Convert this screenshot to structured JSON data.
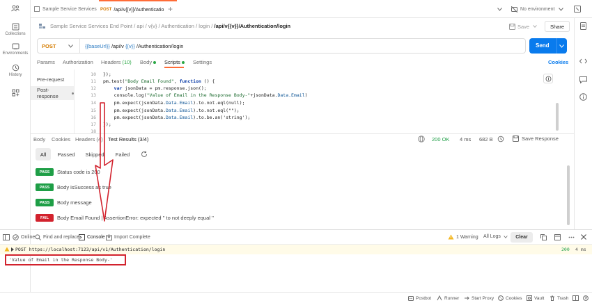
{
  "sidebar": {
    "items": [
      {
        "label": "",
        "icon": "team-icon"
      },
      {
        "label": "Collections",
        "icon": "collections-icon"
      },
      {
        "label": "Environments",
        "icon": "environments-icon"
      },
      {
        "label": "History",
        "icon": "history-icon"
      },
      {
        "label": "",
        "icon": "apps-icon"
      }
    ]
  },
  "tabs": [
    {
      "label": "Sample Service Services",
      "method": ""
    },
    {
      "label": "/api/v{{v}}/Authenticatio",
      "method": "POST"
    }
  ],
  "environment": {
    "label": "No environment"
  },
  "breadcrumb": {
    "items": [
      "Sample Service Services End Point",
      "api",
      "v{v}",
      "Authentication",
      "login"
    ],
    "last": "/api/v{{v}}/Authentication/login"
  },
  "actions": {
    "save": "Save",
    "share": "Share"
  },
  "request": {
    "method": "POST",
    "url_base": "{{baseUrl}}",
    "url_api": "/api/v",
    "url_var": "{{v}}",
    "url_rest": "/Authentication/login",
    "send": "Send"
  },
  "request_tabs": [
    "Params",
    "Authorization",
    "Headers",
    "(10)",
    "Body",
    "Scripts",
    "Settings"
  ],
  "cookies_link": "Cookies",
  "scripts": {
    "pre": "Pre-request",
    "post": "Post-response"
  },
  "code": {
    "line_numbers": [
      "10",
      "11",
      "12",
      "13",
      "14",
      "15",
      "16",
      "17",
      "18"
    ],
    "l10": "});",
    "l11a": "pm.test(",
    "l11b": "\"Body Email Found\"",
    "l11c": ", ",
    "l11d": "function",
    "l11e": " () {",
    "l12a": "    ",
    "l12b": "var",
    "l12c": " jsonData = pm.response.json();",
    "l13a": "    console.log(",
    "l13b": "\"Value of Email in the Response Body-\"",
    "l13c": "+jsonData.",
    "l13d": "Data.Email",
    "l13e": ")",
    "l14a": "    pm.expect(jsonData.",
    "l14b": "Data.Email",
    "l14c": ").to.not.eql(null);",
    "l15a": "    pm.expect(jsonData.",
    "l15b": "Data.Email",
    "l15c": ").to.not.eql(\"\");",
    "l16a": "    pm.expect(jsonData.",
    "l16b": "Data.Email",
    "l16c": ").to.be.an('string');",
    "l17": "});"
  },
  "response": {
    "tabs": [
      "Body",
      "Cookies",
      "Headers (4)",
      "Test Results (3/4)"
    ],
    "status": "200 OK",
    "time": "4 ms",
    "size": "682 B",
    "save": "Save Response"
  },
  "filters": [
    "All",
    "Passed",
    "Skipped",
    "Failed"
  ],
  "tests": [
    {
      "status": "PASS",
      "text": "Status code is 200"
    },
    {
      "status": "PASS",
      "text": "Body isSuccess as true"
    },
    {
      "status": "PASS",
      "text": "Body message"
    },
    {
      "status": "FAIL",
      "text": "Body Email Found | AssertionError: expected '' to not deeply equal ''"
    }
  ],
  "console_bar": {
    "online": "Online",
    "find": "Find and replace",
    "console": "Console",
    "import": "Import Complete",
    "warning": "1 Warning",
    "logs": "All Logs",
    "clear": "Clear"
  },
  "console_log": {
    "method": "POST",
    "url": "https://localhost:7123/api/v1/Authentication/login",
    "status": "200",
    "time": "4 ms",
    "message": "'Value of Email in the Response Body-'"
  },
  "footer": [
    "Postbot",
    "Runner",
    "Start Proxy",
    "Cookies",
    "Vault",
    "Trash"
  ],
  "colors": {
    "accent": "#ff6c37",
    "send": "#097bed",
    "pass": "#1e9e46",
    "fail": "#d2222d",
    "annotation": "#d2222d"
  }
}
